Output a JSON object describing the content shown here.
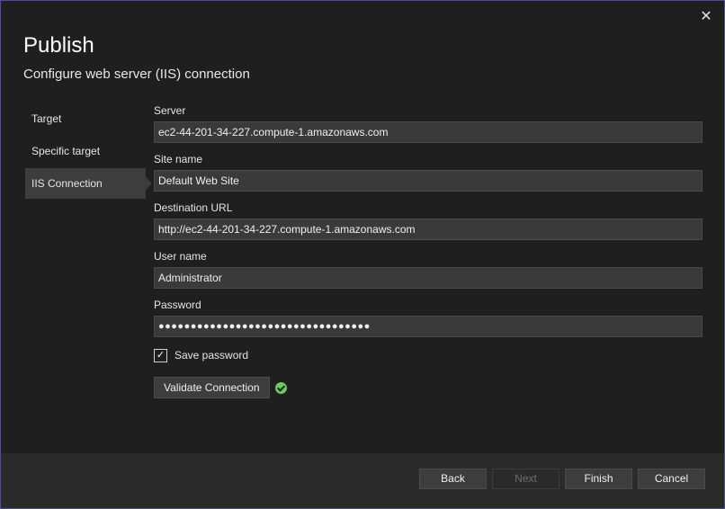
{
  "dialog": {
    "title": "Publish",
    "subtitle": "Configure web server (IIS) connection",
    "close_icon": "close-icon"
  },
  "nav": {
    "items": [
      {
        "label": "Target",
        "active": false
      },
      {
        "label": "Specific target",
        "active": false
      },
      {
        "label": "IIS Connection",
        "active": true
      }
    ]
  },
  "form": {
    "server": {
      "label": "Server",
      "value": "ec2-44-201-34-227.compute-1.amazonaws.com"
    },
    "site_name": {
      "label": "Site name",
      "value": "Default Web Site"
    },
    "destination_url": {
      "label": "Destination URL",
      "value": "http://ec2-44-201-34-227.compute-1.amazonaws.com"
    },
    "user_name": {
      "label": "User name",
      "value": "Administrator"
    },
    "password": {
      "label": "Password",
      "value": "●●●●●●●●●●●●●●●●●●●●●●●●●●●●●●●●●"
    },
    "save_password": {
      "label": "Save password",
      "checked": true,
      "check_glyph": "✓"
    },
    "validate": {
      "label": "Validate Connection",
      "status_icon": "success-check-icon"
    }
  },
  "footer": {
    "back_label": "Back",
    "next_label": "Next",
    "finish_label": "Finish",
    "cancel_label": "Cancel"
  },
  "colors": {
    "background": "#1f1f1f",
    "input_bg": "#3a3a3a",
    "nav_active_bg": "#3d3d3d",
    "footer_bg": "#2b2b2b",
    "success": "#6ccb5f",
    "window_border": "#4f4f8f"
  }
}
